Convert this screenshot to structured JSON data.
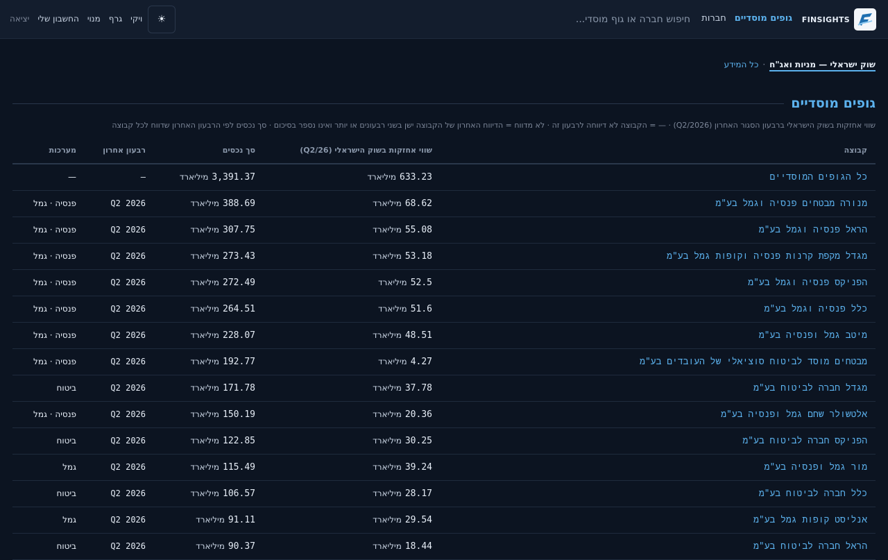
{
  "nav": {
    "brand": "FINSIGHTS",
    "links": [
      "גופים מוסדיים",
      "חברות"
    ],
    "search_placeholder": "חיפוש חברה או גוף מוסדי...",
    "theme_icon": "☀",
    "user_links": [
      "ויקי",
      "גרף",
      "מנוי",
      "החשבון שלי",
      "יציאה"
    ]
  },
  "breadcrumb": {
    "active": "שוק ישראלי — מניות ואג\"ח",
    "separator": "·",
    "link": "כל המידע"
  },
  "section": {
    "title": "גופים מוסדיים",
    "subtitle": "שווי אחזקות בשוק הישראלי ברבעון הסגור האחרון (Q2/2026) · — = הקבוצה לא דיווחה לרבעון זה · לא מדווח = הדיווח האחרון של הקבוצה ישן בשני רבעונים או יותר ואינו נספר בסיכום · סך נכסים לפי הרבעון האחרון שדווח לכל קבוצה"
  },
  "table": {
    "columns": [
      "קבוצה",
      "שווי אחזקות בשוק הישראלי (Q2/26)",
      "סך נכסים",
      "רבעון אחרון",
      "מערכות"
    ],
    "unit": "מיליארד",
    "rows": [
      {
        "name": "כל הגופים המוסדיים",
        "holdings": "633.23",
        "assets": "3,391.37",
        "quarter": "—",
        "systems": "—"
      },
      {
        "name": "מנורה מבטחים פנסיה וגמל בע\"מ",
        "holdings": "68.62",
        "assets": "388.69",
        "quarter": "Q2 2026",
        "systems": "פנסיה · גמל"
      },
      {
        "name": "הראל פנסיה וגמל בע\"מ",
        "holdings": "55.08",
        "assets": "307.75",
        "quarter": "Q2 2026",
        "systems": "פנסיה · גמל"
      },
      {
        "name": "מגדל מקפת קרנות פנסיה וקופות גמל בע\"מ",
        "holdings": "53.18",
        "assets": "273.43",
        "quarter": "Q2 2026",
        "systems": "פנסיה · גמל"
      },
      {
        "name": "הפניקס פנסיה וגמל בע\"מ",
        "holdings": "52.5",
        "assets": "272.49",
        "quarter": "Q2 2026",
        "systems": "פנסיה · גמל"
      },
      {
        "name": "כלל פנסיה וגמל בע\"מ",
        "holdings": "51.6",
        "assets": "264.51",
        "quarter": "Q2 2026",
        "systems": "פנסיה · גמל"
      },
      {
        "name": "מיטב גמל ופנסיה בע\"מ",
        "holdings": "48.51",
        "assets": "228.07",
        "quarter": "Q2 2026",
        "systems": "פנסיה · גמל"
      },
      {
        "name": "מבטחים מוסד לביטוח סוציאלי של העובדים בע\"מ",
        "holdings": "4.27",
        "assets": "192.77",
        "quarter": "Q2 2026",
        "systems": "פנסיה · גמל"
      },
      {
        "name": "מגדל חברה לביטוח בע\"מ",
        "holdings": "37.78",
        "assets": "171.78",
        "quarter": "Q2 2026",
        "systems": "ביטוח"
      },
      {
        "name": "אלטשולר שחם גמל ופנסיה בע\"מ",
        "holdings": "20.36",
        "assets": "150.19",
        "quarter": "Q2 2026",
        "systems": "פנסיה · גמל"
      },
      {
        "name": "הפניקס חברה לביטוח בע\"מ",
        "holdings": "30.25",
        "assets": "122.85",
        "quarter": "Q2 2026",
        "systems": "ביטוח"
      },
      {
        "name": "מור גמל ופנסיה בע\"מ",
        "holdings": "39.24",
        "assets": "115.49",
        "quarter": "Q2 2026",
        "systems": "גמל"
      },
      {
        "name": "כלל חברה לביטוח בע\"מ",
        "holdings": "28.17",
        "assets": "106.57",
        "quarter": "Q2 2026",
        "systems": "ביטוח"
      },
      {
        "name": "אנליסט קופות גמל בע\"מ",
        "holdings": "29.54",
        "assets": "91.11",
        "quarter": "Q2 2026",
        "systems": "גמל"
      },
      {
        "name": "הראל חברה לביטוח בע\"מ",
        "holdings": "18.44",
        "assets": "90.37",
        "quarter": "Q2 2026",
        "systems": "ביטוח"
      }
    ]
  }
}
